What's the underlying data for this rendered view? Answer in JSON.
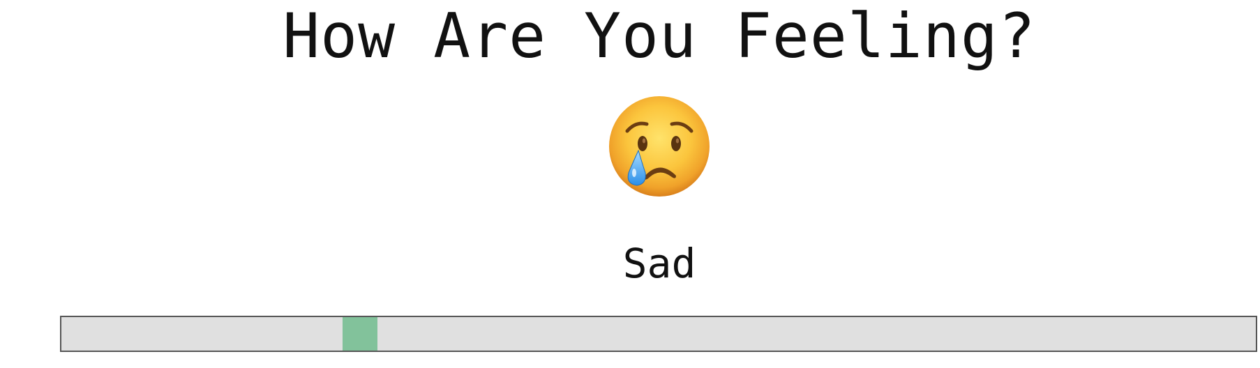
{
  "title": "How Are You Feeling?",
  "mood": {
    "label": "Sad",
    "emoji_icon": "crying-face-emoji"
  },
  "slider": {
    "value_fraction": 0.25,
    "track_color": "#e0e0e0",
    "thumb_color": "#82c29b",
    "border_color": "#555555"
  }
}
